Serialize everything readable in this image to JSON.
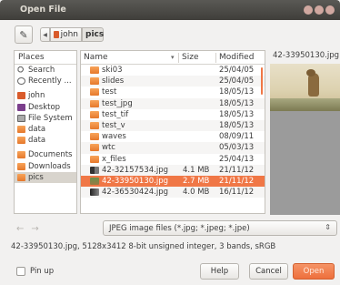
{
  "window": {
    "title": "Open File"
  },
  "toolbar": {
    "path": [
      {
        "label": "john",
        "icon": "home-icon"
      },
      {
        "label": "pics"
      }
    ]
  },
  "places": {
    "header": "Places",
    "items": [
      {
        "label": "Search",
        "icon": "search-icon"
      },
      {
        "label": "Recently ...",
        "icon": "clock-icon"
      },
      {
        "label": "john",
        "icon": "home-icon"
      },
      {
        "label": "Desktop",
        "icon": "desktop-icon"
      },
      {
        "label": "File System",
        "icon": "drive-icon"
      },
      {
        "label": "data",
        "icon": "folder-icon"
      },
      {
        "label": "data",
        "icon": "folder-icon"
      },
      {
        "label": "Documents",
        "icon": "folder-icon"
      },
      {
        "label": "Downloads",
        "icon": "folder-icon"
      },
      {
        "label": "pics",
        "icon": "folder-icon",
        "selected": true
      }
    ]
  },
  "files": {
    "columns": {
      "name": "Name",
      "size": "Size",
      "modified": "Modified"
    },
    "rows": [
      {
        "name": "ski03",
        "size": "",
        "modified": "25/04/05",
        "icon": "folder-icon"
      },
      {
        "name": "slides",
        "size": "",
        "modified": "25/04/05",
        "icon": "folder-icon"
      },
      {
        "name": "test",
        "size": "",
        "modified": "18/05/13",
        "icon": "folder-icon"
      },
      {
        "name": "test_jpg",
        "size": "",
        "modified": "18/05/13",
        "icon": "folder-icon"
      },
      {
        "name": "test_tif",
        "size": "",
        "modified": "18/05/13",
        "icon": "folder-icon"
      },
      {
        "name": "test_v",
        "size": "",
        "modified": "18/05/13",
        "icon": "folder-icon"
      },
      {
        "name": "waves",
        "size": "",
        "modified": "08/09/11",
        "icon": "folder-icon"
      },
      {
        "name": "wtc",
        "size": "",
        "modified": "05/03/13",
        "icon": "folder-icon"
      },
      {
        "name": "x_files",
        "size": "",
        "modified": "25/04/13",
        "icon": "folder-icon"
      },
      {
        "name": "42-32157534.jpg",
        "size": "4.1 MB",
        "modified": "21/11/12",
        "icon": "image-icon"
      },
      {
        "name": "42-33950130.jpg",
        "size": "2.7 MB",
        "modified": "21/11/12",
        "icon": "image-icon",
        "selected": true
      },
      {
        "name": "42-36530424.jpg",
        "size": "4.0 MB",
        "modified": "16/11/12",
        "icon": "image-icon"
      }
    ]
  },
  "preview": {
    "label": "42-33950130.jpg"
  },
  "filter": {
    "selected": "JPEG image files (*.jpg; *.jpeg; *.jpe)"
  },
  "info": {
    "text": "42-33950130.jpg, 5128x3412 8-bit unsigned integer, 3 bands, sRGB"
  },
  "footer": {
    "pin_label": "Pin up",
    "help_label": "Help",
    "cancel_label": "Cancel",
    "open_label": "Open"
  },
  "colors": {
    "accent": "#f07746",
    "titlebar": "#3f3e3a",
    "folder": "#e5782b"
  }
}
